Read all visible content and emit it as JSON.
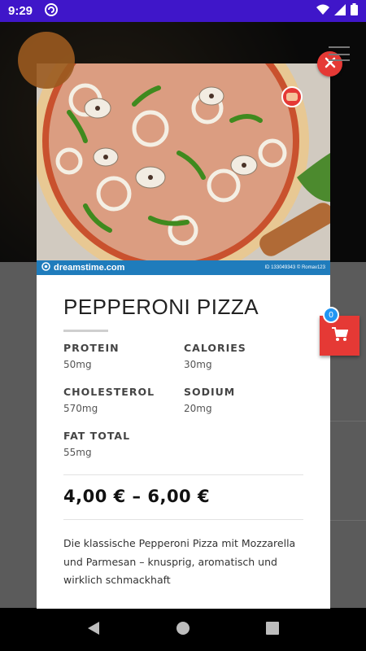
{
  "status_bar": {
    "time": "9:29"
  },
  "product": {
    "title": "PEPPERONI PIZZA",
    "nutrition": [
      {
        "label": "PROTEIN",
        "value": "50mg"
      },
      {
        "label": "CALORIES",
        "value": "30mg"
      },
      {
        "label": "CHOLESTEROL",
        "value": "570mg"
      },
      {
        "label": "SODIUM",
        "value": "20mg"
      },
      {
        "label": "FAT TOTAL",
        "value": "55mg"
      }
    ],
    "price": "4,00 € – 6,00 €",
    "description": "Die klassische Pepperoni Pizza mit Mozzarella und Parmesan – knusprig, aromatisch und wirklich schmackhaft"
  },
  "image_watermark": {
    "brand": "dreamstime.com",
    "id_text": "ID 133049343 © Romav123"
  },
  "cart": {
    "count": "0"
  },
  "colors": {
    "accent": "#e53935",
    "badge": "#2196f3",
    "status_bar": "#3f16c9"
  },
  "icons": [
    "close-icon",
    "cart-icon",
    "back-icon",
    "home-icon",
    "recents-icon",
    "wifi-icon",
    "signal-icon",
    "battery-icon"
  ]
}
